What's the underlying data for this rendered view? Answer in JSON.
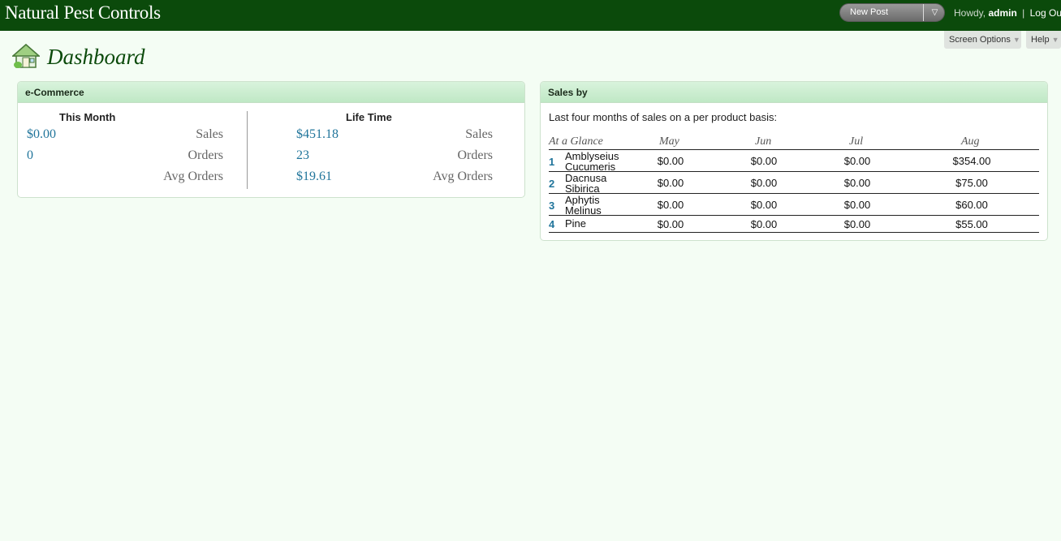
{
  "header": {
    "site_title": "Natural Pest Controls",
    "favorite_action": "New Post",
    "howdy_prefix": "Howdy,",
    "username": "admin",
    "separator": "|",
    "logout": "Log Out",
    "background": "#0b4a0b"
  },
  "screen_meta": {
    "screen_options": "Screen Options",
    "help": "Help"
  },
  "page": {
    "title": "Dashboard",
    "title_color": "#0b4a0b"
  },
  "ecommerce": {
    "title": "e-Commerce",
    "this_month": {
      "heading": "This Month",
      "sales_value": "$0.00",
      "sales_label": "Sales",
      "orders_value": "0",
      "orders_label": "Orders",
      "avg_label": "Avg Orders"
    },
    "life_time": {
      "heading": "Life Time",
      "sales_value": "$451.18",
      "sales_label": "Sales",
      "orders_value": "23",
      "orders_label": "Orders",
      "avg_value": "$19.61",
      "avg_label": "Avg Orders"
    }
  },
  "sales_by": {
    "title": "Sales by",
    "description": "Last four months of sales on a per product basis:",
    "columns": [
      "At a Glance",
      "May",
      "Jun",
      "Jul",
      "Aug"
    ],
    "rows": [
      {
        "rank": "1",
        "name_line1": "Amblyseius",
        "name_line2": "Cucumeris",
        "may": "$0.00",
        "jun": "$0.00",
        "jul": "$0.00",
        "aug": "$354.00"
      },
      {
        "rank": "2",
        "name_line1": "Dacnusa",
        "name_line2": "Sibirica",
        "may": "$0.00",
        "jun": "$0.00",
        "jul": "$0.00",
        "aug": "$75.00"
      },
      {
        "rank": "3",
        "name_line1": "Aphytis",
        "name_line2": "Melinus",
        "may": "$0.00",
        "jun": "$0.00",
        "jul": "$0.00",
        "aug": "$60.00"
      },
      {
        "rank": "4",
        "name_line1": "Pine",
        "name_line2": "",
        "may": "$0.00",
        "jun": "$0.00",
        "jul": "$0.00",
        "aug": "$55.00"
      }
    ]
  }
}
